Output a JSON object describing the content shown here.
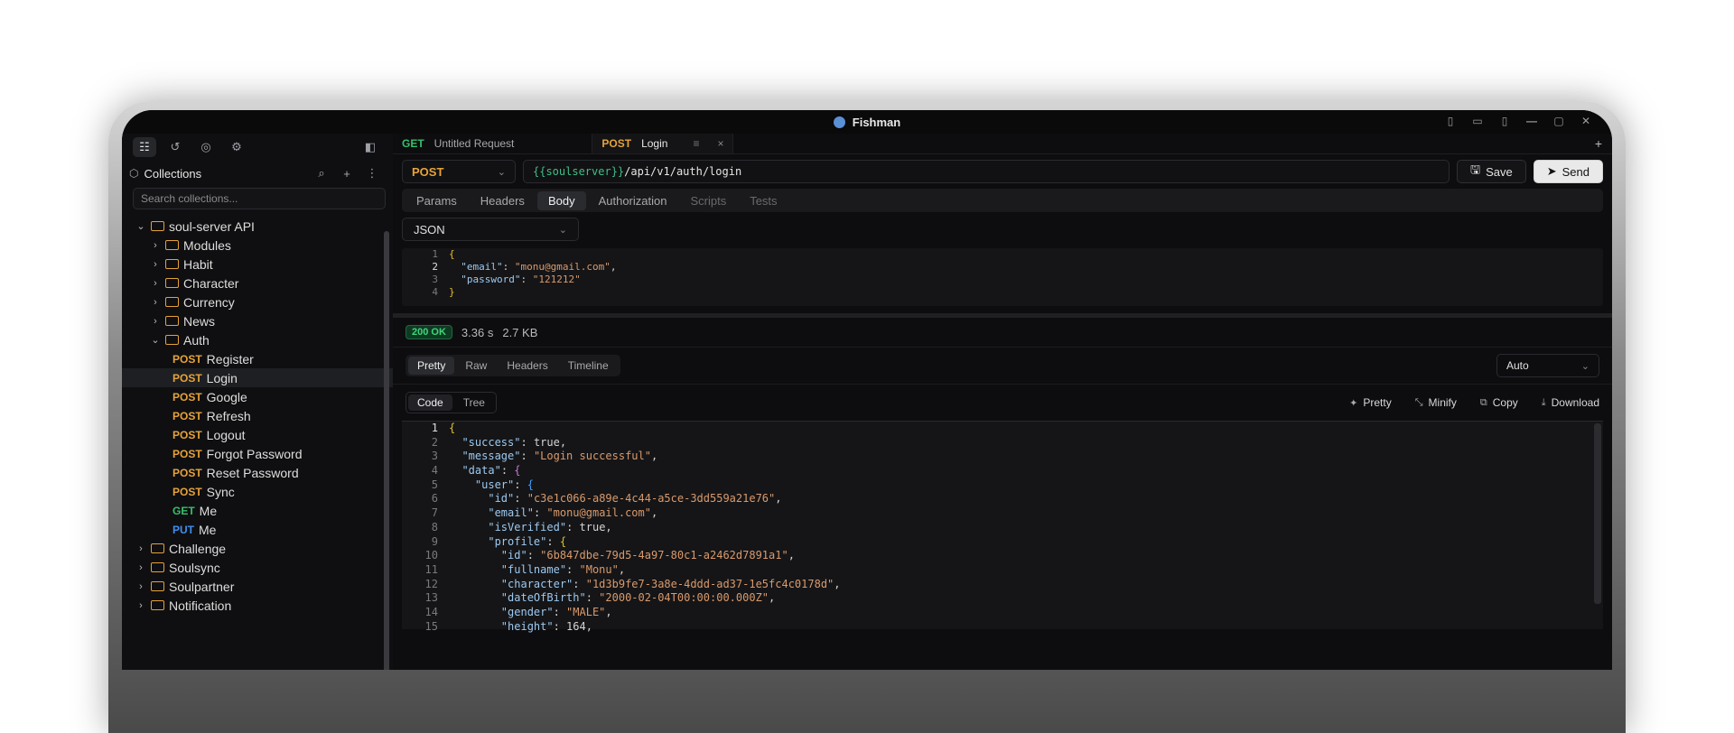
{
  "window": {
    "title": "Fishman"
  },
  "sidebar": {
    "header": "Collections",
    "search_placeholder": "Search collections...",
    "tree": [
      {
        "type": "folder",
        "label": "soul-server API",
        "chevron": "⌄",
        "indent": 0
      },
      {
        "type": "folder",
        "label": "Modules",
        "chevron": "›",
        "indent": 1
      },
      {
        "type": "folder",
        "label": "Habit",
        "chevron": "›",
        "indent": 1
      },
      {
        "type": "folder",
        "label": "Character",
        "chevron": "›",
        "indent": 1
      },
      {
        "type": "folder",
        "label": "Currency",
        "chevron": "›",
        "indent": 1
      },
      {
        "type": "folder",
        "label": "News",
        "chevron": "›",
        "indent": 1
      },
      {
        "type": "folder",
        "label": "Auth",
        "chevron": "⌄",
        "indent": 1
      },
      {
        "type": "request",
        "method": "POST",
        "label": "Register",
        "indent": 2
      },
      {
        "type": "request",
        "method": "POST",
        "label": "Login",
        "indent": 2,
        "selected": true
      },
      {
        "type": "request",
        "method": "POST",
        "label": "Google",
        "indent": 2
      },
      {
        "type": "request",
        "method": "POST",
        "label": "Refresh",
        "indent": 2
      },
      {
        "type": "request",
        "method": "POST",
        "label": "Logout",
        "indent": 2
      },
      {
        "type": "request",
        "method": "POST",
        "label": "Forgot Password",
        "indent": 2
      },
      {
        "type": "request",
        "method": "POST",
        "label": "Reset Password",
        "indent": 2
      },
      {
        "type": "request",
        "method": "POST",
        "label": "Sync",
        "indent": 2
      },
      {
        "type": "request",
        "method": "GET",
        "label": "Me",
        "indent": 2
      },
      {
        "type": "request",
        "method": "PUT",
        "label": "Me",
        "indent": 2
      },
      {
        "type": "folder",
        "label": "Challenge",
        "chevron": "›",
        "indent": 0
      },
      {
        "type": "folder",
        "label": "Soulsync",
        "chevron": "›",
        "indent": 0
      },
      {
        "type": "folder",
        "label": "Soulpartner",
        "chevron": "›",
        "indent": 0
      },
      {
        "type": "folder",
        "label": "Notification",
        "chevron": "›",
        "indent": 0
      }
    ]
  },
  "tabs": [
    {
      "method": "GET",
      "label": "Untitled Request",
      "active": false
    },
    {
      "method": "POST",
      "label": "Login",
      "active": true
    }
  ],
  "request": {
    "method": "POST",
    "url_var": "{{soulserver}}",
    "url_path": "/api/v1/auth/login",
    "save_label": "Save",
    "send_label": "Send",
    "tabs": [
      "Params",
      "Headers",
      "Body",
      "Authorization",
      "Scripts",
      "Tests"
    ],
    "active_tab": "Body",
    "body_type": "JSON",
    "body_lines": [
      {
        "n": "1",
        "html": "<span class=\"b\">{</span>"
      },
      {
        "n": "2",
        "html": "  <span class=\"k\">\"email\"</span>: <span class=\"s\">\"monu@gmail.com\"</span>,"
      },
      {
        "n": "3",
        "html": "  <span class=\"k\">\"password\"</span>: <span class=\"s\">\"121212\"</span>"
      },
      {
        "n": "4",
        "html": "<span class=\"b\">}</span>"
      }
    ]
  },
  "response": {
    "status": "200 OK",
    "time": "3.36 s",
    "size": "2.7 KB",
    "tabs": [
      "Pretty",
      "Raw",
      "Headers",
      "Timeline"
    ],
    "active_tab": "Pretty",
    "format": "Auto",
    "view_tabs": [
      "Code",
      "Tree"
    ],
    "active_view": "Code",
    "actions": [
      "Pretty",
      "Minify",
      "Copy",
      "Download"
    ],
    "lines": [
      {
        "n": "1",
        "html": "<span class=\"b\">{</span>"
      },
      {
        "n": "2",
        "html": "  <span class=\"k\">\"success\"</span>: <span class=\"kw\">true</span>,"
      },
      {
        "n": "3",
        "html": "  <span class=\"k\">\"message\"</span>: <span class=\"s\">\"Login successful\"</span>,"
      },
      {
        "n": "4",
        "html": "  <span class=\"k\">\"data\"</span>: <span class=\"p\">{</span>"
      },
      {
        "n": "5",
        "html": "    <span class=\"k\">\"user\"</span>: <span class=\"bl\">{</span>"
      },
      {
        "n": "6",
        "html": "      <span class=\"k\">\"id\"</span>: <span class=\"s\">\"c3e1c066-a89e-4c44-a5ce-3dd559a21e76\"</span>,"
      },
      {
        "n": "7",
        "html": "      <span class=\"k\">\"email\"</span>: <span class=\"s\">\"monu@gmail.com\"</span>,"
      },
      {
        "n": "8",
        "html": "      <span class=\"k\">\"isVerified\"</span>: <span class=\"kw\">true</span>,"
      },
      {
        "n": "9",
        "html": "      <span class=\"k\">\"profile\"</span>: <span class=\"b\">{</span>"
      },
      {
        "n": "10",
        "html": "        <span class=\"k\">\"id\"</span>: <span class=\"s\">\"6b847dbe-79d5-4a97-80c1-a2462d7891a1\"</span>,"
      },
      {
        "n": "11",
        "html": "        <span class=\"k\">\"fullname\"</span>: <span class=\"s\">\"Monu\"</span>,"
      },
      {
        "n": "12",
        "html": "        <span class=\"k\">\"character\"</span>: <span class=\"s\">\"1d3b9fe7-3a8e-4ddd-ad37-1e5fc4c0178d\"</span>,"
      },
      {
        "n": "13",
        "html": "        <span class=\"k\">\"dateOfBirth\"</span>: <span class=\"s\">\"2000-02-04T00:00:00.000Z\"</span>,"
      },
      {
        "n": "14",
        "html": "        <span class=\"k\">\"gender\"</span>: <span class=\"s\">\"MALE\"</span>,"
      },
      {
        "n": "15",
        "html": "        <span class=\"k\">\"height\"</span>: <span class=\"kw\">164</span>,"
      }
    ]
  }
}
